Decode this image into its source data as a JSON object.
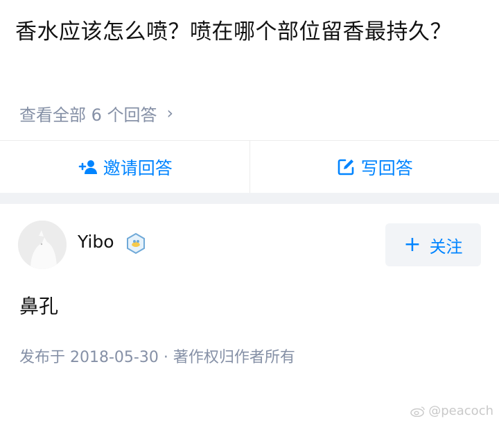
{
  "question": {
    "title": "香水应该怎么喷？喷在哪个部位留香最持久？",
    "view_all": "查看全部 6 个回答"
  },
  "actions": {
    "invite_label": "邀请回答",
    "write_label": "写回答"
  },
  "answer": {
    "author": "Yibo",
    "follow_label": "关注",
    "content": "鼻孔",
    "meta": "发布于 2018-05-30 · 著作权归作者所有"
  },
  "watermark": "@peacoch",
  "colors": {
    "accent": "#0084ff",
    "muted": "#8590a6",
    "divider": "#f0f2f5"
  }
}
